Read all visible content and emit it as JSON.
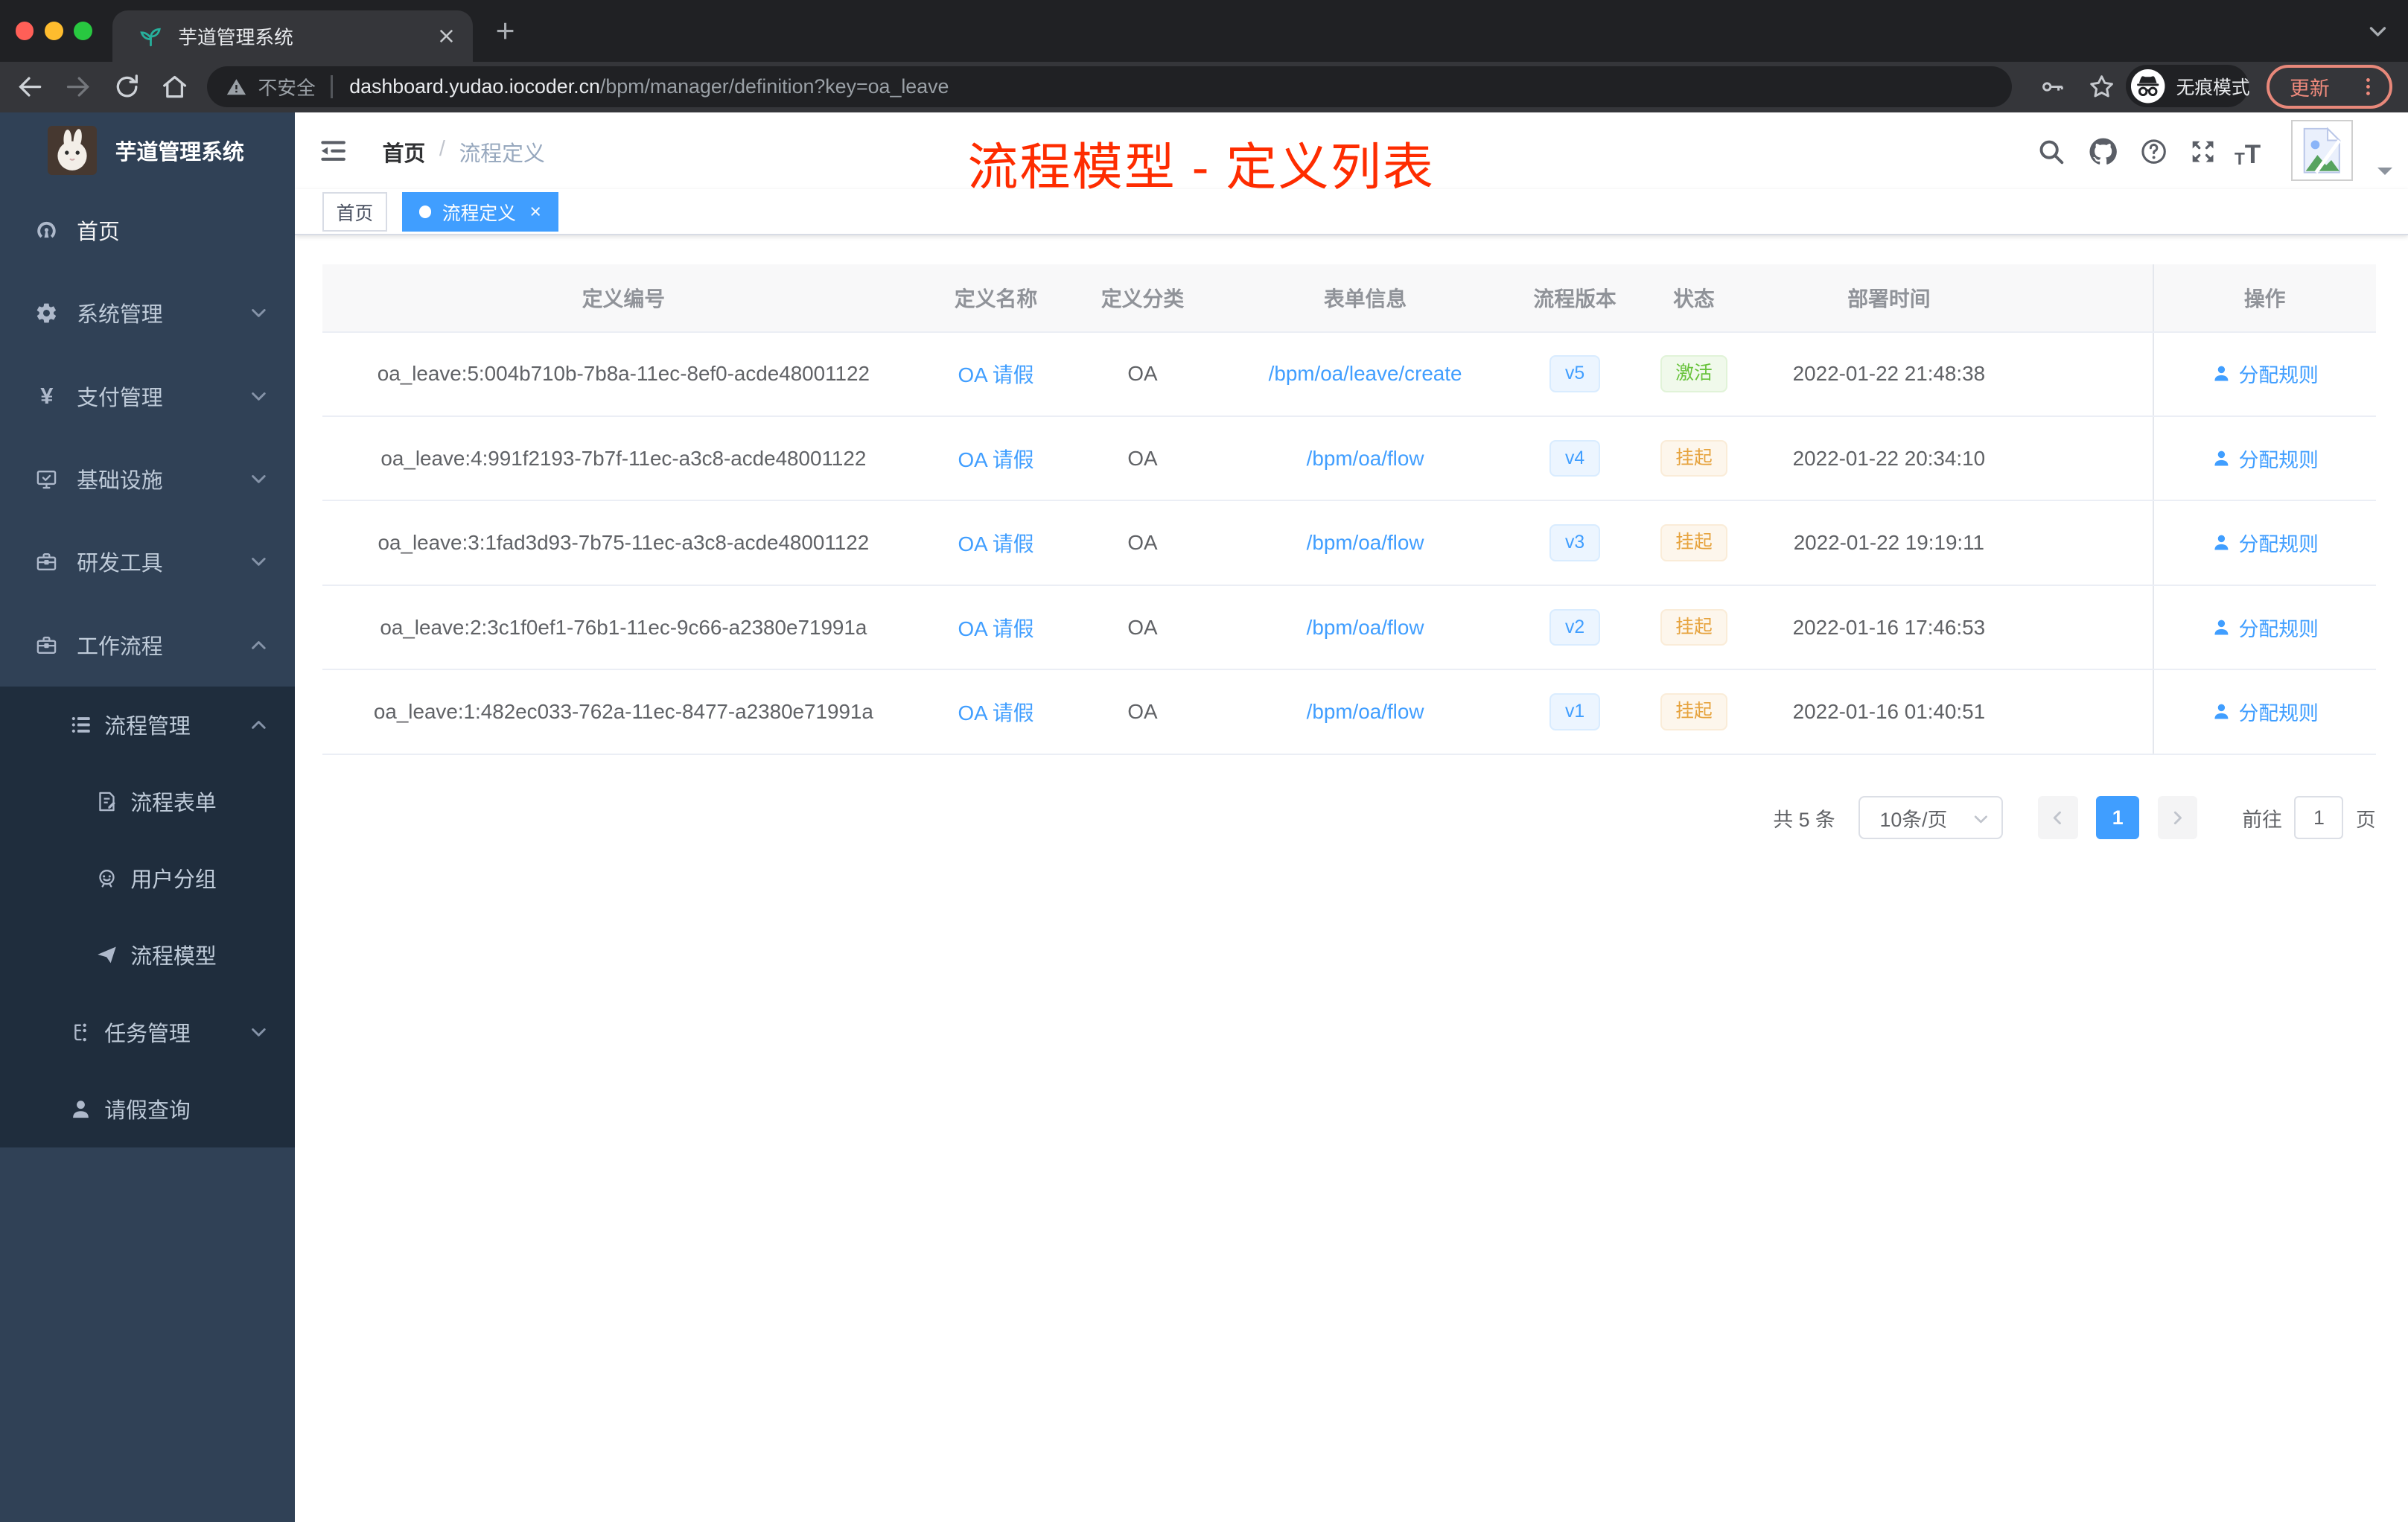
{
  "browser": {
    "tab_title": "芋道管理系统",
    "security_label": "不安全",
    "url_domain": "dashboard.yudao.iocoder.cn",
    "url_path": "/bpm/manager/definition?key=oa_leave",
    "incognito_label": "无痕模式",
    "update_label": "更新"
  },
  "sidebar": {
    "app_title": "芋道管理系统",
    "menu": [
      {
        "name": "home",
        "icon": "dashboard-icon",
        "glyph": "dashboard",
        "label": "首页",
        "arrow": null,
        "level": 1,
        "dark": false
      },
      {
        "name": "system-management",
        "icon": "gear-icon",
        "glyph": "gear",
        "label": "系统管理",
        "arrow": "down",
        "level": 1,
        "dark": false
      },
      {
        "name": "payment-management",
        "icon": "yen-icon",
        "glyph": "yen",
        "label": "支付管理",
        "arrow": "down",
        "level": 1,
        "dark": false
      },
      {
        "name": "infrastructure",
        "icon": "monitor-icon",
        "glyph": "monitor",
        "label": "基础设施",
        "arrow": "down",
        "level": 1,
        "dark": false
      },
      {
        "name": "dev-tools",
        "icon": "toolbox-icon",
        "glyph": "briefcase",
        "label": "研发工具",
        "arrow": "down",
        "level": 1,
        "dark": false
      },
      {
        "name": "workflow",
        "icon": "briefcase-icon",
        "glyph": "briefcase",
        "label": "工作流程",
        "arrow": "up",
        "level": 1,
        "dark": false
      },
      {
        "name": "process-management",
        "icon": "list-icon",
        "glyph": "list",
        "label": "流程管理",
        "arrow": "up",
        "level": 2,
        "dark": true
      },
      {
        "name": "process-form",
        "icon": "form-icon",
        "glyph": "form",
        "label": "流程表单",
        "arrow": null,
        "level": 3,
        "dark": true
      },
      {
        "name": "user-group",
        "icon": "user-group-icon",
        "glyph": "user-group",
        "label": "用户分组",
        "arrow": null,
        "level": 3,
        "dark": true
      },
      {
        "name": "process-model",
        "icon": "paper-plane-icon",
        "glyph": "paper-plane",
        "label": "流程模型",
        "arrow": null,
        "level": 3,
        "dark": true
      },
      {
        "name": "task-management",
        "icon": "tasks-icon",
        "glyph": "tasks",
        "label": "任务管理",
        "arrow": "down",
        "level": 2,
        "dark": true
      },
      {
        "name": "leave-query",
        "icon": "user-icon",
        "glyph": "user",
        "label": "请假查询",
        "arrow": null,
        "level": 2,
        "dark": true
      }
    ]
  },
  "navbar": {
    "breadcrumb": {
      "home": "首页",
      "separator": "/",
      "current": "流程定义"
    },
    "annotation": "流程模型 - 定义列表"
  },
  "tags": {
    "home_label": "首页",
    "active_label": "流程定义",
    "close_glyph": "×"
  },
  "table": {
    "columns": [
      {
        "label": "定义编号"
      },
      {
        "label": "定义名称"
      },
      {
        "label": "定义分类"
      },
      {
        "label": "表单信息"
      },
      {
        "label": "流程版本"
      },
      {
        "label": "状态"
      },
      {
        "label": "部署时间"
      },
      {
        "label": "操作"
      }
    ],
    "rows": [
      {
        "id": "oa_leave:5:004b710b-7b8a-11ec-8ef0-acde48001122",
        "name": "OA 请假",
        "category": "OA",
        "form": "/bpm/oa/leave/create",
        "version": "v5",
        "status": "激活",
        "status_type": "success",
        "deployed": "2022-01-22 21:48:38",
        "action": "分配规则"
      },
      {
        "id": "oa_leave:4:991f2193-7b7f-11ec-a3c8-acde48001122",
        "name": "OA 请假",
        "category": "OA",
        "form": "/bpm/oa/flow",
        "version": "v4",
        "status": "挂起",
        "status_type": "warning",
        "deployed": "2022-01-22 20:34:10",
        "action": "分配规则"
      },
      {
        "id": "oa_leave:3:1fad3d93-7b75-11ec-a3c8-acde48001122",
        "name": "OA 请假",
        "category": "OA",
        "form": "/bpm/oa/flow",
        "version": "v3",
        "status": "挂起",
        "status_type": "warning",
        "deployed": "2022-01-22 19:19:11",
        "action": "分配规则"
      },
      {
        "id": "oa_leave:2:3c1f0ef1-76b1-11ec-9c66-a2380e71991a",
        "name": "OA 请假",
        "category": "OA",
        "form": "/bpm/oa/flow",
        "version": "v2",
        "status": "挂起",
        "status_type": "warning",
        "deployed": "2022-01-16 17:46:53",
        "action": "分配规则"
      },
      {
        "id": "oa_leave:1:482ec033-762a-11ec-8477-a2380e71991a",
        "name": "OA 请假",
        "category": "OA",
        "form": "/bpm/oa/flow",
        "version": "v1",
        "status": "挂起",
        "status_type": "warning",
        "deployed": "2022-01-16 01:40:51",
        "action": "分配规则"
      }
    ]
  },
  "pagination": {
    "total": "共 5 条",
    "page_size": "10条/页",
    "current_page": "1",
    "goto_prefix": "前往",
    "goto_value": "1",
    "goto_suffix": "页"
  },
  "colors": {
    "primary": "#409eff",
    "success": "#67c23a",
    "warning": "#e6a23c",
    "annotation_red": "#fe2c00",
    "sidebar_bg": "#304156",
    "submenu_bg": "#1f2d3d"
  }
}
